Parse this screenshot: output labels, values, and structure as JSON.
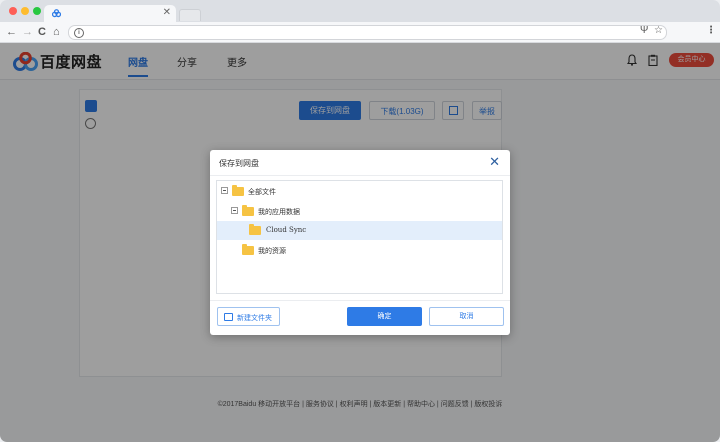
{
  "browser": {
    "tab_close": "✕",
    "nav_back": "←",
    "nav_forward": "→",
    "nav_reload": "C",
    "nav_home": "⌂",
    "info_glyph": "i",
    "mic_icon": "Ψ",
    "star_icon": "☆",
    "menu_icon": "⋮"
  },
  "header": {
    "brand": "百度网盘",
    "nav": [
      "网盘",
      "分享",
      "更多"
    ],
    "active_nav": "网盘",
    "vip_label": "会员中心",
    "bell_icon": "bell-icon",
    "clipboard_icon": "clipboard-icon"
  },
  "toolbar": {
    "save_label": "保存到网盘",
    "download_label": "下载(1.03G)",
    "report_label": "举报"
  },
  "footer": {
    "text": "©2017Baidu 移动开放平台 | 服务协议 | 权利声明 | 版本更新 | 帮助中心 | 问题反馈 | 版权投诉"
  },
  "modal": {
    "title": "保存到网盘",
    "close_glyph": "✕",
    "tree": [
      {
        "label": "全部文件",
        "level": 0,
        "expanded": true,
        "selected": false
      },
      {
        "label": "我的应用数据",
        "level": 1,
        "expanded": true,
        "selected": false
      },
      {
        "label": "Cloud Sync",
        "level": 2,
        "expanded": false,
        "selected": true
      },
      {
        "label": "我的资源",
        "level": 1,
        "expanded": false,
        "selected": false
      }
    ],
    "new_folder_label": "新建文件夹",
    "ok_label": "确定",
    "cancel_label": "取消"
  },
  "colors": {
    "accent": "#2e7be6",
    "vip": "#ee4c3d",
    "folder": "#f6c343",
    "selected_row": "#e3eefb"
  }
}
